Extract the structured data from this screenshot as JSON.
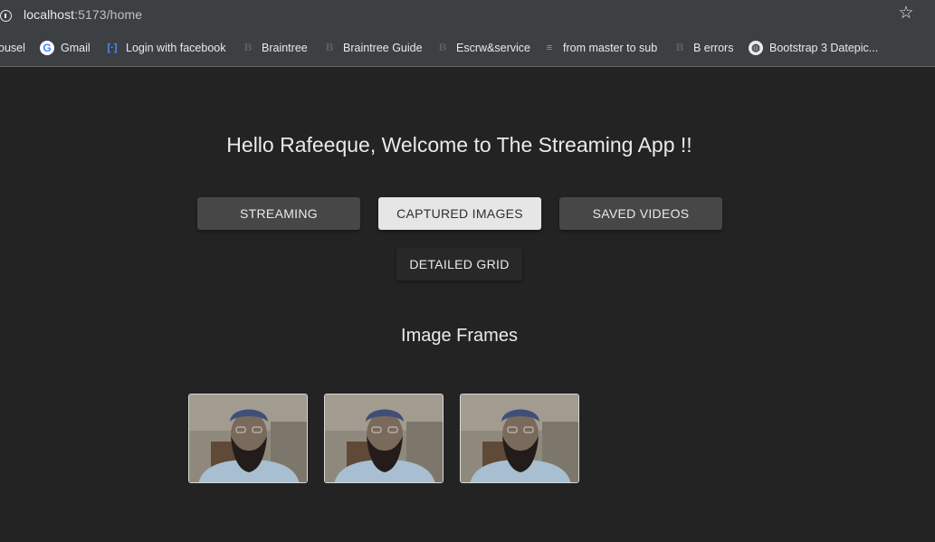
{
  "browser": {
    "url_host": "localhost",
    "url_path": ":5173/home",
    "bookmarks": [
      {
        "label": "ousel",
        "icon": "none"
      },
      {
        "label": "Gmail",
        "icon": "google-icon"
      },
      {
        "label": "Login with facebook",
        "icon": "facebook-icon"
      },
      {
        "label": "Braintree",
        "icon": "b-icon"
      },
      {
        "label": "Braintree Guide",
        "icon": "b-icon"
      },
      {
        "label": "Escrw&service",
        "icon": "b-icon"
      },
      {
        "label": "from master to sub",
        "icon": "stackoverflow-icon"
      },
      {
        "label": "B errors",
        "icon": "b-icon"
      },
      {
        "label": "Bootstrap 3 Datepic...",
        "icon": "globe-icon"
      }
    ]
  },
  "page": {
    "greeting": "Hello Rafeeque, Welcome to The Streaming App !!",
    "buttons": {
      "streaming": "STREAMING",
      "captured_images": "CAPTURED IMAGES",
      "saved_videos": "SAVED VIDEOS",
      "detailed_grid": "DETAILED GRID"
    },
    "section_title": "Image Frames",
    "frames": [
      "captured-frame",
      "captured-frame",
      "captured-frame"
    ]
  },
  "colors": {
    "background": "#232323",
    "browser_chrome": "#3c4043",
    "button_dark": "#474747",
    "button_selected": "#e6e6e6"
  }
}
